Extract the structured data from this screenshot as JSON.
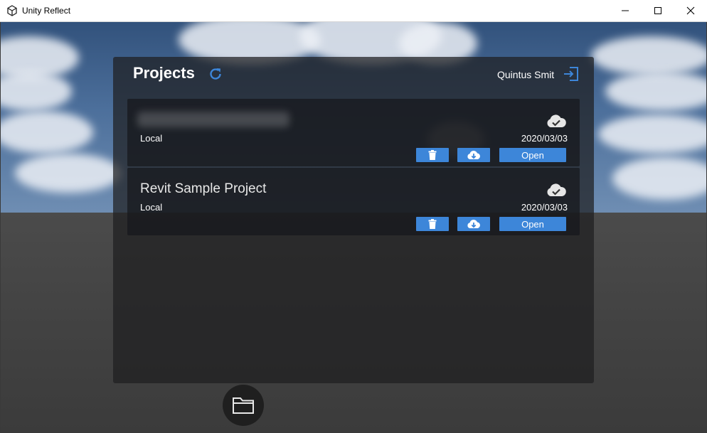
{
  "window": {
    "title": "Unity Reflect"
  },
  "panel": {
    "title": "Projects",
    "user_name": "Quintus Smit"
  },
  "projects": [
    {
      "name": "",
      "name_redacted": true,
      "location": "Local",
      "date": "2020/03/03",
      "status_icon": "cloud-check-icon",
      "open_label": "Open"
    },
    {
      "name": "Revit Sample Project",
      "location": "Local",
      "date": "2020/03/03",
      "status_icon": "cloud-check-icon",
      "open_label": "Open"
    }
  ],
  "icons": {
    "refresh": "refresh-icon",
    "logout": "logout-icon",
    "delete": "trash-icon",
    "download": "cloud-download-icon",
    "folder": "folder-icon"
  },
  "colors": {
    "accent": "#3d86d9",
    "panel_bg": "#1e1e20"
  }
}
